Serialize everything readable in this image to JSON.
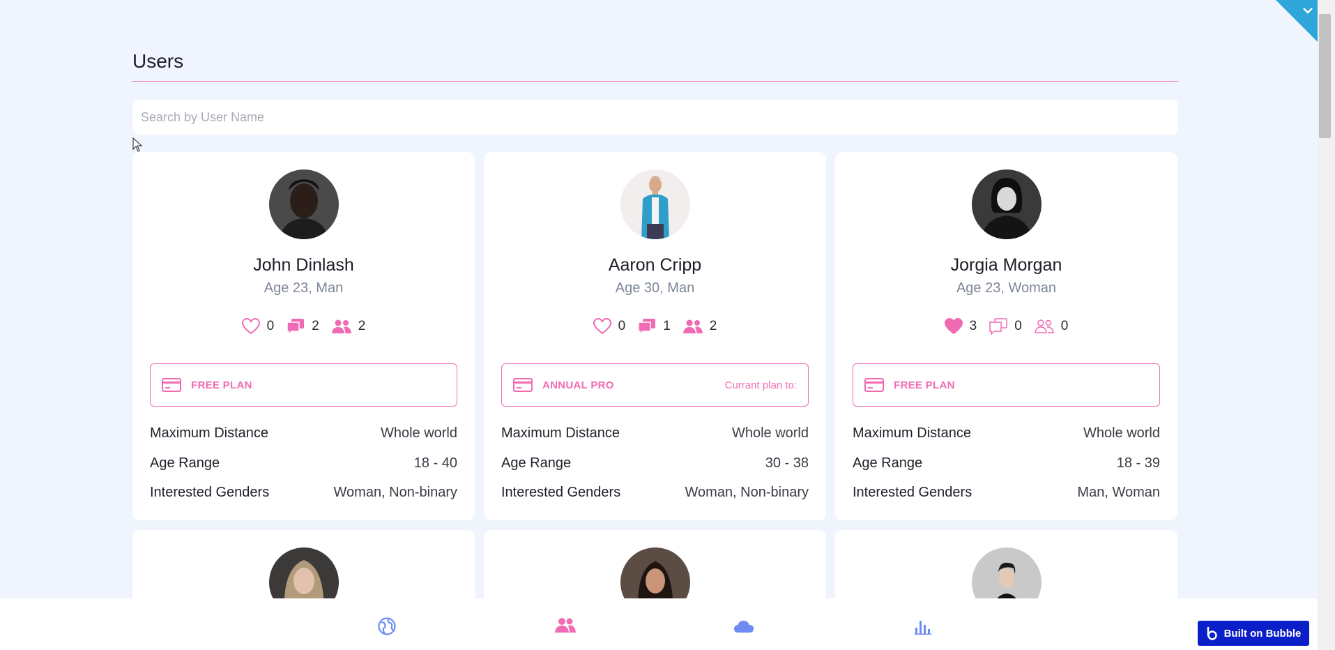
{
  "page": {
    "title": "Users"
  },
  "search": {
    "placeholder": "Search by User Name"
  },
  "labels": {
    "max_distance": "Maximum Distance",
    "age_range": "Age Range",
    "interested_genders": "Interested Genders"
  },
  "users": [
    {
      "name": "John Dinlash",
      "sub": "Age 23, Man",
      "likes": "0",
      "messages": "2",
      "matches": "2",
      "plan": "FREE PLAN",
      "plan_note": "",
      "max_distance": "Whole world",
      "age_range": "18 - 40",
      "interested_genders": "Woman, Non-binary"
    },
    {
      "name": "Aaron Cripp",
      "sub": "Age 30, Man",
      "likes": "0",
      "messages": "1",
      "matches": "2",
      "plan": "ANNUAL PRO",
      "plan_note": "Currant plan to:",
      "max_distance": "Whole world",
      "age_range": "30 - 38",
      "interested_genders": "Woman, Non-binary"
    },
    {
      "name": "Jorgia Morgan",
      "sub": "Age 23, Woman",
      "likes": "3",
      "messages": "0",
      "matches": "0",
      "plan": "FREE PLAN",
      "plan_note": "",
      "max_distance": "Whole world",
      "age_range": "18 - 39",
      "interested_genders": "Man, Woman"
    }
  ],
  "footer": {
    "badge": "Built on Bubble"
  },
  "colors": {
    "accent": "#f06bb3",
    "nav_blue": "#6f8cf2",
    "badge_blue": "#0b1fc9",
    "background": "#eff4fd"
  },
  "icons": [
    "globe-icon",
    "users-icon",
    "cloud-icon",
    "bar-chart-icon",
    "heart-icon",
    "chat-icon",
    "people-icon",
    "credit-card-icon",
    "chevron-down-icon"
  ]
}
